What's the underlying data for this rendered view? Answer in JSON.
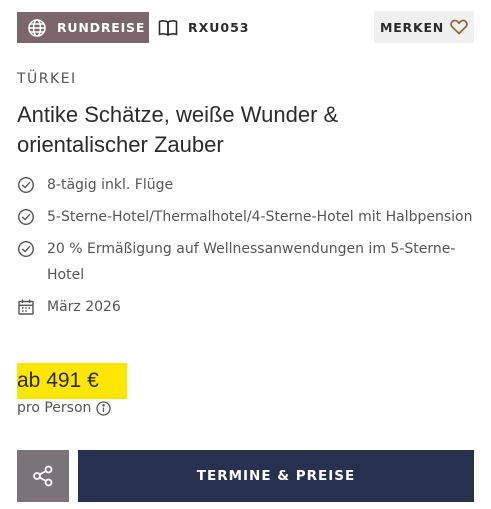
{
  "header": {
    "type_badge": {
      "icon": "globe-icon",
      "label": "RUNDREISE",
      "bg": "#7a666b"
    },
    "trip_code": {
      "icon": "book-icon",
      "label": "RXU053"
    },
    "bookmark": {
      "label": "MERKEN",
      "icon": "heart-icon",
      "icon_color": "#8a6a35"
    }
  },
  "trip": {
    "country": "TÜRKEI",
    "title": "Antike Schätze, weiße Wunder & orientalischer Zauber",
    "features": [
      {
        "icon": "check-circle-icon",
        "text": "8-tägig inkl. Flüge"
      },
      {
        "icon": "check-circle-icon",
        "text": "5-Sterne-Hotel/Thermalhotel/4-Sterne-Hotel mit Halbpension"
      },
      {
        "icon": "check-circle-icon",
        "text": "20 % Ermäßigung auf Wellnessanwendungen im 5-Sterne-Hotel"
      },
      {
        "icon": "calendar-icon",
        "text": "März 2026"
      }
    ]
  },
  "pricing": {
    "price": "ab 491 €",
    "per_person": "pro Person",
    "info_icon": "info-icon",
    "highlight": "#ffe600"
  },
  "actions": {
    "share_icon": "share-icon",
    "share_bg": "#7a7478",
    "cta_label": "TERMINE & PREISE",
    "cta_bg": "#27304f"
  }
}
